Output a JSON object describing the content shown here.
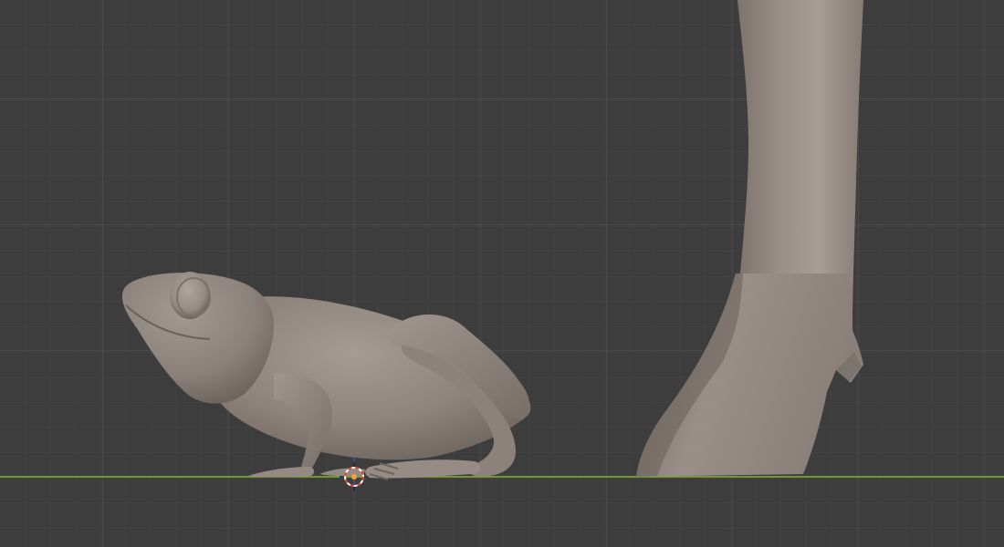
{
  "viewport": {
    "background_color": "#3d3d3d",
    "minor_grid_color": "#474747",
    "major_grid_color": "#555555",
    "x_axis_color": "#7fb02c",
    "z_axis_color": "#2d5aa0",
    "mesh_base_color": "#8c8079",
    "mesh_highlight_color": "#a59a92",
    "mesh_shadow_color": "#5e5550"
  },
  "scene": {
    "objects": [
      {
        "name": "frog",
        "type": "mesh"
      },
      {
        "name": "leg-hoof",
        "type": "mesh"
      }
    ],
    "cursor_icon": "3d-cursor-icon"
  }
}
